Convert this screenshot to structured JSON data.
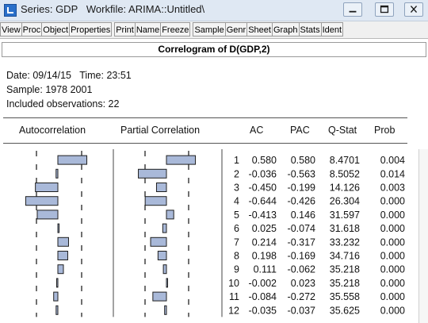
{
  "window": {
    "title": "Series: GDP   Workfile: ARIMA::Untitled\\",
    "controls": [
      "minimize-icon",
      "maximize-icon",
      "close-icon"
    ]
  },
  "toolbar": {
    "buttons": [
      "View",
      "Proc",
      "Object",
      "Properties",
      "Print",
      "Name",
      "Freeze",
      "Sample",
      "Genr",
      "Sheet",
      "Graph",
      "Stats",
      "Ident"
    ]
  },
  "view": {
    "title": "Correlogram of D(GDP,2)",
    "date_line": "Date: 09/14/15   Time: 23:51",
    "sample_line": "Sample: 1978 2001",
    "obs_line": "Included observations: 22"
  },
  "columns": {
    "autocorrelation": "Autocorrelation",
    "partial_correlation": "Partial Correlation",
    "ac": "AC",
    "pac": "PAC",
    "qstat": "Q-Stat",
    "prob": "Prob"
  },
  "rows": [
    {
      "lag": "1",
      "ac": "0.580",
      "pac": "0.580",
      "q": "8.4701",
      "prob": "0.004"
    },
    {
      "lag": "2",
      "ac": "-0.036",
      "pac": "-0.563",
      "q": "8.5052",
      "prob": "0.014"
    },
    {
      "lag": "3",
      "ac": "-0.450",
      "pac": "-0.199",
      "q": "14.126",
      "prob": "0.003"
    },
    {
      "lag": "4",
      "ac": "-0.644",
      "pac": "-0.426",
      "q": "26.304",
      "prob": "0.000"
    },
    {
      "lag": "5",
      "ac": "-0.413",
      "pac": "0.146",
      "q": "31.597",
      "prob": "0.000"
    },
    {
      "lag": "6",
      "ac": "0.025",
      "pac": "-0.074",
      "q": "31.618",
      "prob": "0.000"
    },
    {
      "lag": "7",
      "ac": "0.214",
      "pac": "-0.317",
      "q": "33.232",
      "prob": "0.000"
    },
    {
      "lag": "8",
      "ac": "0.198",
      "pac": "-0.169",
      "q": "34.716",
      "prob": "0.000"
    },
    {
      "lag": "9",
      "ac": "0.111",
      "pac": "-0.062",
      "q": "35.218",
      "prob": "0.000"
    },
    {
      "lag": "10",
      "ac": "-0.002",
      "pac": "0.023",
      "q": "35.218",
      "prob": "0.000"
    },
    {
      "lag": "11",
      "ac": "-0.084",
      "pac": "-0.272",
      "q": "35.558",
      "prob": "0.000"
    },
    {
      "lag": "12",
      "ac": "-0.035",
      "pac": "-0.037",
      "q": "35.625",
      "prob": "0.000"
    }
  ],
  "colors": {
    "bar_fill": "#a9b9d9",
    "bar_stroke": "#1f1f1f",
    "titlebar": "#dfe8f3"
  }
}
